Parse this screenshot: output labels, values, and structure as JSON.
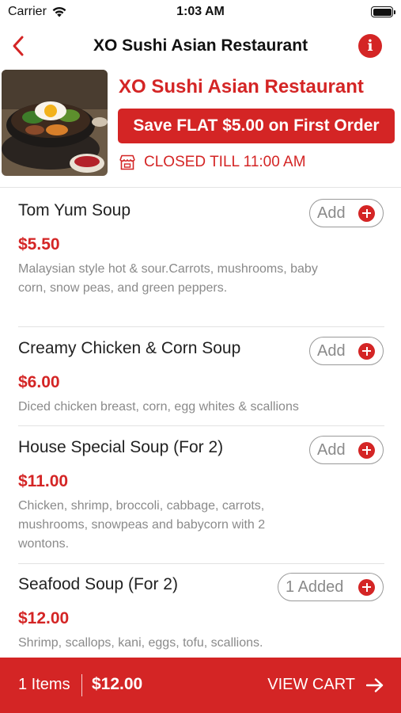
{
  "status": {
    "carrier": "Carrier",
    "time": "1:03 AM"
  },
  "nav": {
    "title": "XO Sushi Asian Restaurant",
    "back_icon": "chevron-left-icon",
    "info_icon": "info-icon",
    "accent": "#d42525"
  },
  "restaurant": {
    "name": "XO Sushi Asian Restaurant",
    "promo": "Save FLAT $5.00 on First Order",
    "status": "CLOSED TILL 11:00 AM",
    "status_icon": "storefront-icon"
  },
  "menu": {
    "items": [
      {
        "name": "Tom Yum Soup",
        "price": "$5.50",
        "desc": "Malaysian style hot & sour.Carrots, mushrooms, baby corn, snow peas, and green peppers.",
        "button": "Add"
      },
      {
        "name": "Creamy Chicken & Corn Soup",
        "price": "$6.00",
        "desc": "Diced chicken breast, corn, egg whites & scallions",
        "button": "Add"
      },
      {
        "name": "House Special Soup (For 2)",
        "price": "$11.00",
        "desc": "Chicken, shrimp, broccoli, cabbage, carrots, mushrooms, snowpeas and babycorn with 2 wontons.",
        "button": "Add"
      },
      {
        "name": "Seafood Soup (For 2)",
        "price": "$12.00",
        "desc": "Shrimp, scallops, kani, eggs, tofu, scallions.",
        "button": "1 Added"
      }
    ]
  },
  "cart": {
    "count": "1 Items",
    "total": "$12.00",
    "view_label": "VIEW CART"
  }
}
